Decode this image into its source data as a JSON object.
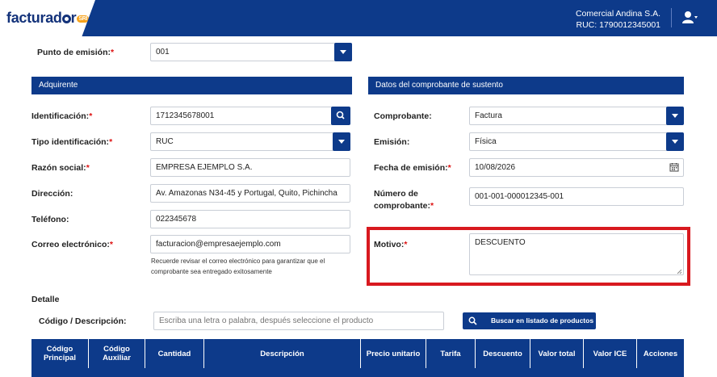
{
  "header": {
    "logo_text": "facturad",
    "logo_badge": "SRI",
    "company_name": "Comercial Andina S.A.",
    "company_ruc": "RUC: 1790012345001",
    "user_icon": "user-icon"
  },
  "punto_emision": {
    "label": "Punto de emisión:",
    "required": "*",
    "value": "001"
  },
  "adquirente": {
    "title": "Adquirente",
    "identificacion": {
      "label": "Identificación:",
      "required": "*",
      "value": "1712345678001"
    },
    "tipo_identificacion": {
      "label": "Tipo identificación:",
      "required": "*",
      "value": "RUC"
    },
    "razon_social": {
      "label": "Razón social:",
      "required": "*",
      "value": "EMPRESA EJEMPLO S.A."
    },
    "direccion": {
      "label": "Dirección:",
      "value": "Av. Amazonas N34-45 y Portugal, Quito, Pichincha"
    },
    "telefono": {
      "label": "Teléfono:",
      "value": "022345678"
    },
    "correo": {
      "label": "Correo electrónico:",
      "required": "*",
      "value": "facturacion@empresaejemplo.com",
      "hint_line1": "Recuerde revisar el correo electrónico para garantizar que el",
      "hint_line2": "comprobante sea entregado exitosamente"
    }
  },
  "sustento": {
    "title": "Datos del comprobante de sustento",
    "comprobante": {
      "label": "Comprobante:",
      "value": "Factura"
    },
    "emision": {
      "label": "Emisión:",
      "value": "Física"
    },
    "fecha_emision": {
      "label": "Fecha de emisión:",
      "required": "*",
      "value": "10/08/2026"
    },
    "numero_comprobante": {
      "label_line1": "Número de",
      "label_line2": "comprobante:",
      "required": "*",
      "value": "001-001-000012345-001"
    },
    "motivo": {
      "label": "Motivo:",
      "required": "*",
      "value": "DESCUENTO"
    }
  },
  "detalle": {
    "title": "Detalle",
    "codigo_label": "Código / Descripción:",
    "search_placeholder": "Escriba una letra o palabra, después seleccione el producto",
    "search_button": "Buscar en listado de productos"
  },
  "table": {
    "columns": [
      {
        "line1": "Código",
        "line2": "Principal"
      },
      {
        "line1": "Código",
        "line2": "Auxiliar"
      },
      {
        "line1": "Cantidad",
        "line2": ""
      },
      {
        "line1": "Descripción",
        "line2": ""
      },
      {
        "line1": "Precio unitario",
        "line2": ""
      },
      {
        "line1": "Tarifa",
        "line2": ""
      },
      {
        "line1": "Descuento",
        "line2": ""
      },
      {
        "line1": "Valor total",
        "line2": ""
      },
      {
        "line1": "Valor ICE",
        "line2": ""
      },
      {
        "line1": "Acciones",
        "line2": ""
      }
    ]
  },
  "colors": {
    "primary": "#0d3a8a",
    "highlight": "#d8191f",
    "required": "#dd1111"
  }
}
